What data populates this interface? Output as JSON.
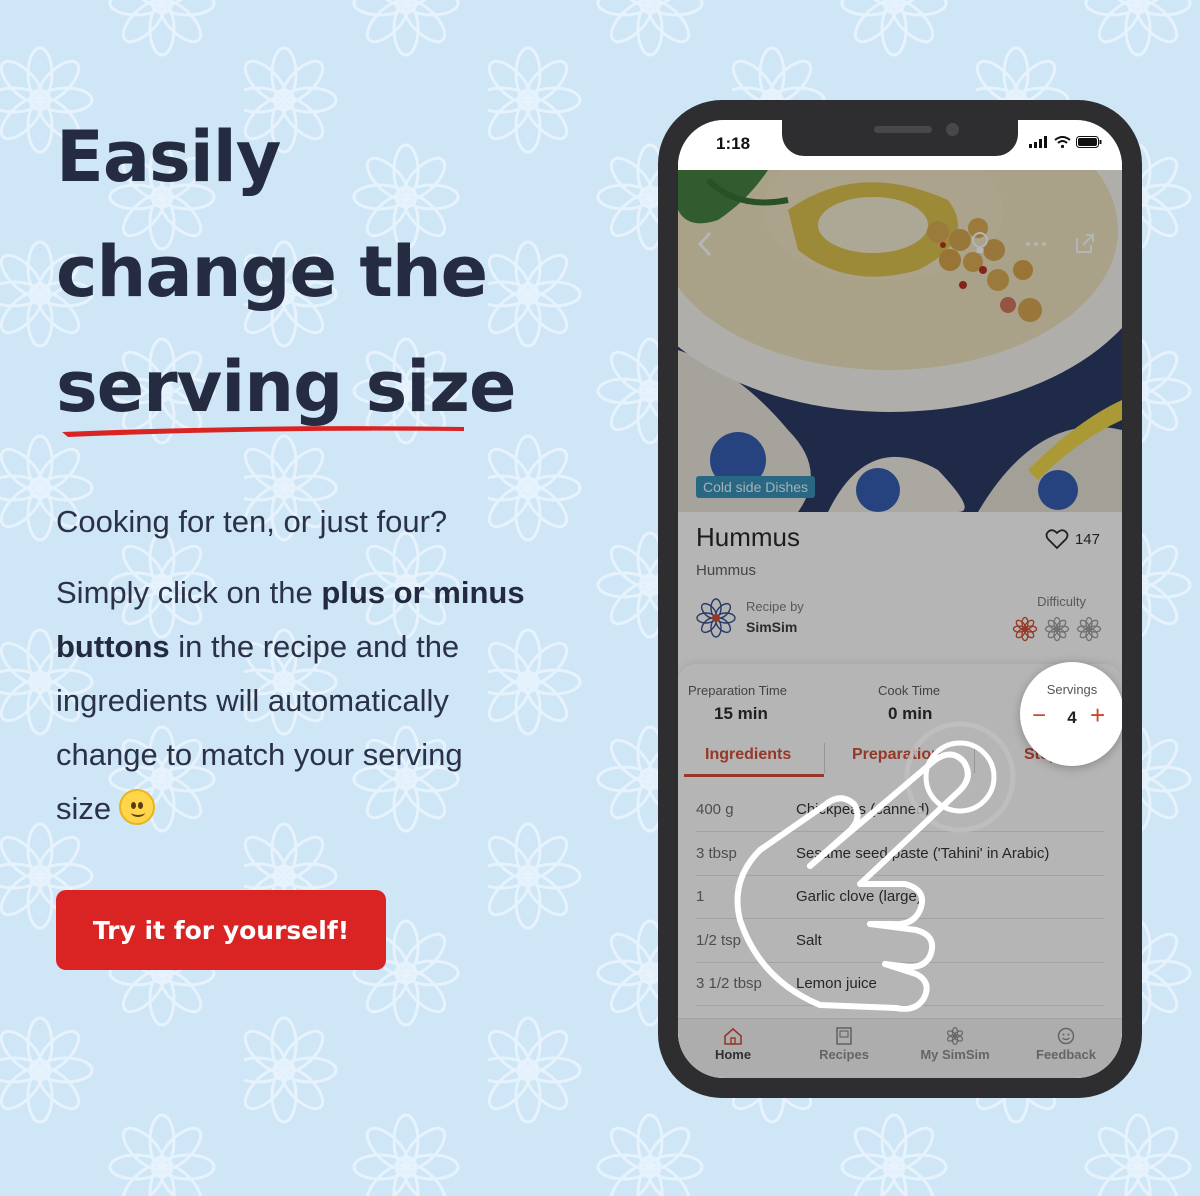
{
  "headline": {
    "line1": "Easily",
    "line2": "change the",
    "line3": "serving size"
  },
  "question": "Cooking for ten, or just four?",
  "description": {
    "part1": "Simply click on the ",
    "bold": "plus or minus buttons",
    "part2": " in the recipe and the ingredients will automatically change to match your serving size"
  },
  "cta_label": "Try it for yourself!",
  "colors": {
    "background": "#cfe6f7",
    "accent": "#da2424",
    "headline": "#252b41",
    "app_accent": "#d0452c"
  },
  "phone": {
    "status_time": "1:18",
    "category_tag": "Cold side Dishes",
    "recipe_title": "Hummus",
    "recipe_subtitle": "Hummus",
    "likes": "147",
    "recipe_by_label": "Recipe by",
    "author": "SimSim",
    "difficulty_label": "Difficulty",
    "difficulty_level": 1,
    "difficulty_max": 3,
    "prep_time_label": "Preparation Time",
    "prep_time": "15 min",
    "cook_time_label": "Cook Time",
    "cook_time": "0 min",
    "servings_label": "Servings",
    "servings": "4",
    "minus": "−",
    "plus": "+",
    "tabs": [
      "Ingredients",
      "Preparation",
      "Steps"
    ],
    "ingredients": [
      {
        "qty": "400 g",
        "name": "Chickpeas (canned)"
      },
      {
        "qty": "3 tbsp",
        "name": "Sesame seed paste ('Tahini' in Arabic)"
      },
      {
        "qty": "1",
        "name": "Garlic clove (large)"
      },
      {
        "qty": "1/2 tsp",
        "name": "Salt"
      },
      {
        "qty": "3 1/2 tbsp",
        "name": "Lemon juice"
      }
    ],
    "nav": [
      "Home",
      "Recipes",
      "My SimSim",
      "Feedback"
    ],
    "icons": [
      "back-chevron-icon",
      "lightbulb-icon",
      "more-icon",
      "share-icon",
      "heart-icon",
      "signal-icon",
      "wifi-icon",
      "battery-icon",
      "home-icon",
      "recipes-icon",
      "my-simsim-icon",
      "feedback-icon",
      "tap-hand-icon",
      "smiley-emoji-icon"
    ]
  }
}
